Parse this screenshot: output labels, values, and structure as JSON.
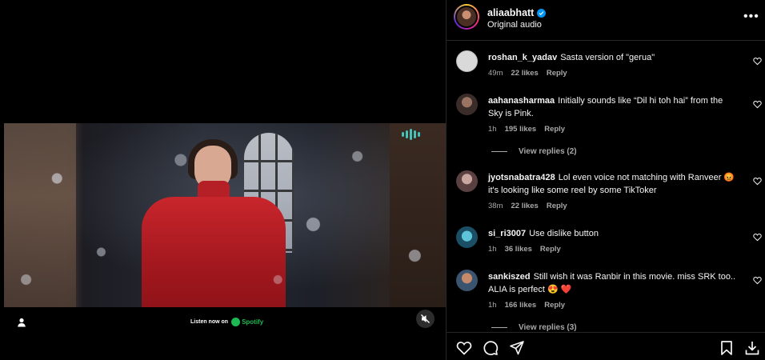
{
  "media": {
    "listen_label": "Listen now on",
    "spotify_label": "Spotify"
  },
  "header": {
    "username": "aliaabhatt",
    "subtitle": "Original audio"
  },
  "comments": [
    {
      "user": "roshan_k_yadav",
      "text": "Sasta version of \"gerua\"",
      "time": "49m",
      "likes": "22 likes",
      "reply": "Reply"
    },
    {
      "user": "aahanasharmaa",
      "text": "Initially sounds like “Dil hi toh hai” from the Sky is Pink.",
      "time": "1h",
      "likes": "195 likes",
      "reply": "Reply",
      "view_replies": "View replies (2)"
    },
    {
      "user": "jyotsnabatra428",
      "text": "Lol even voice not matching with Ranveer 😡 it's looking like some reel by some TikToker",
      "time": "38m",
      "likes": "22 likes",
      "reply": "Reply"
    },
    {
      "user": "si_ri3007",
      "text": "Use dislike button",
      "time": "1h",
      "likes": "36 likes",
      "reply": "Reply"
    },
    {
      "user": "sankiszed",
      "text": "Still wish it was Ranbir in this movie. miss SRK too.. ALIA is perfect 😍 ❤️",
      "time": "1h",
      "likes": "166 likes",
      "reply": "Reply",
      "view_replies": "View replies (3)"
    }
  ],
  "colors": {
    "background": "#000000",
    "text": "#f5f5f5",
    "muted": "#a8a8a8",
    "verified": "#0095f6",
    "spotify": "#1db954",
    "coat": "#c8262c"
  }
}
